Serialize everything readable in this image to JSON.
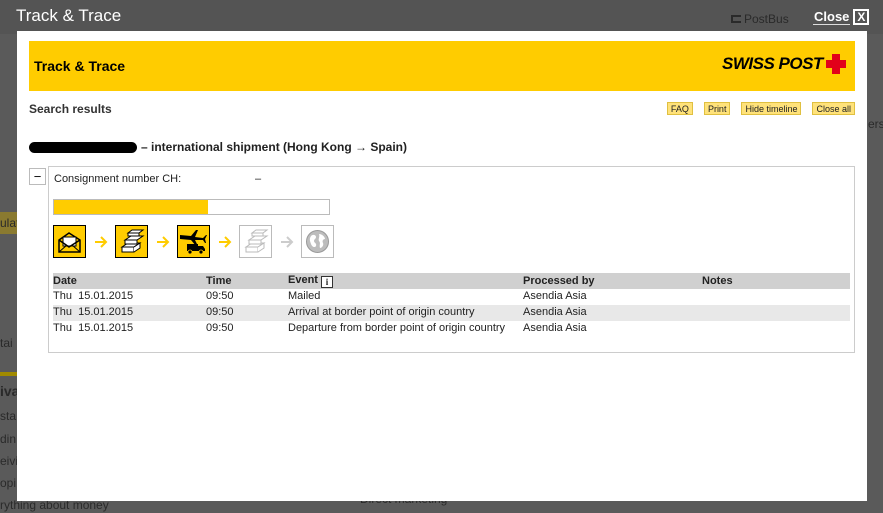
{
  "backdrop": {
    "postbus": "PostBus",
    "fragments": [
      "ers",
      "ulat",
      "tai",
      "iva",
      "sta",
      "din",
      "eivi",
      "opi",
      "rything about money",
      "Direct marketing"
    ]
  },
  "modal": {
    "window_title": "Track & Trace",
    "close_label": "Close",
    "close_x": "X",
    "header_title": "Track & Trace",
    "logo_text": "SWISS POST"
  },
  "toolbar": {
    "search_results": "Search results",
    "faq": "FAQ",
    "print": "Print",
    "hide_timeline": "Hide timeline",
    "close_all": "Close all"
  },
  "shipment": {
    "description": "– international shipment (Hong Kong → Spain)",
    "toggle": "−",
    "consignment_label": "Consignment number CH:",
    "consignment_value": "–",
    "progress_fraction": 0.56
  },
  "timeline": {
    "steps": [
      {
        "icon": "parcel-posted-icon",
        "status": "done"
      },
      {
        "icon": "parcels-sorted-icon",
        "status": "done"
      },
      {
        "icon": "plane-truck-icon",
        "status": "done"
      },
      {
        "icon": "parcels-pending-icon",
        "status": "pending"
      },
      {
        "icon": "globe-icon",
        "status": "pending"
      }
    ]
  },
  "table": {
    "headers": {
      "date": "Date",
      "time": "Time",
      "event": "Event",
      "processed_by": "Processed by",
      "notes": "Notes"
    },
    "info_glyph": "i",
    "rows": [
      {
        "day": "Thu",
        "date": "15.01.2015",
        "time": "09:50",
        "event": "Mailed",
        "processed_by": "Asendia Asia",
        "notes": ""
      },
      {
        "day": "Thu",
        "date": "15.01.2015",
        "time": "09:50",
        "event": "Arrival at border point of origin country",
        "processed_by": "Asendia Asia",
        "notes": ""
      },
      {
        "day": "Thu",
        "date": "15.01.2015",
        "time": "09:50",
        "event": "Departure from border point of origin country",
        "processed_by": "Asendia Asia",
        "notes": ""
      }
    ]
  },
  "colors": {
    "brand_yellow": "#ffcc00",
    "logo_red": "#e2001a",
    "arrow_done": "#ffcc00",
    "arrow_pending": "#cccccc"
  }
}
